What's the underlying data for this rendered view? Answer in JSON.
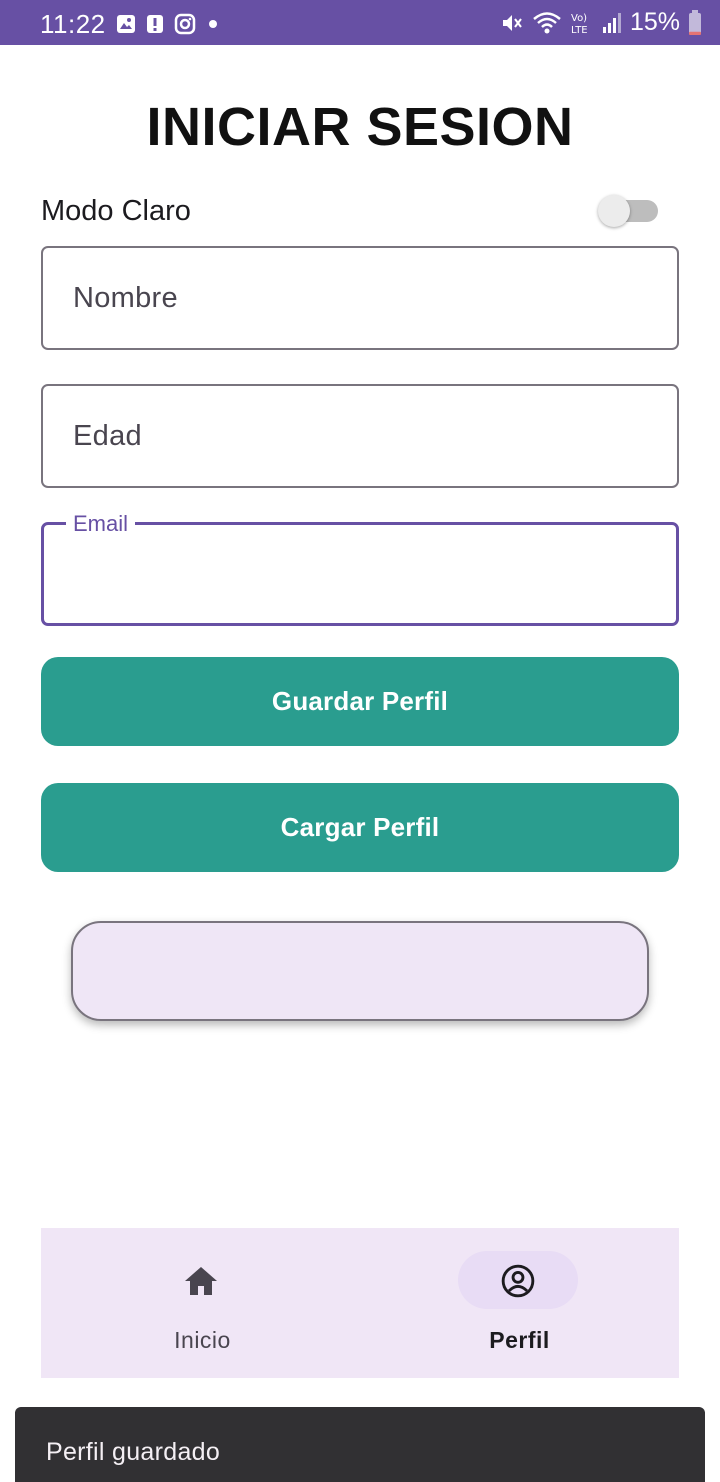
{
  "status_bar": {
    "time": "11:22",
    "battery": "15%",
    "icons_left": [
      "gallery-icon",
      "alert-icon",
      "instagram-icon",
      "dot-icon"
    ],
    "icons_right": [
      "mute-icon",
      "wifi-icon",
      "volte-icon",
      "signal-icon",
      "battery-icon"
    ],
    "battery_level": 0.15,
    "color": "#6750a4"
  },
  "title": "INICIAR SESION",
  "theme_toggle": {
    "label": "Modo Claro",
    "on": false
  },
  "form": {
    "name_placeholder": "Nombre",
    "age_placeholder": "Edad",
    "email_label": "Email",
    "email_value": ""
  },
  "buttons": {
    "save": "Guardar Perfil",
    "load": "Cargar Perfil",
    "color": "#2a9d8f"
  },
  "bottom_nav": {
    "items": [
      {
        "label": "Inicio",
        "icon": "home-icon",
        "selected": false
      },
      {
        "label": "Perfil",
        "icon": "account-circle-icon",
        "selected": true
      }
    ]
  },
  "snackbar": {
    "message": "Perfil guardado"
  }
}
